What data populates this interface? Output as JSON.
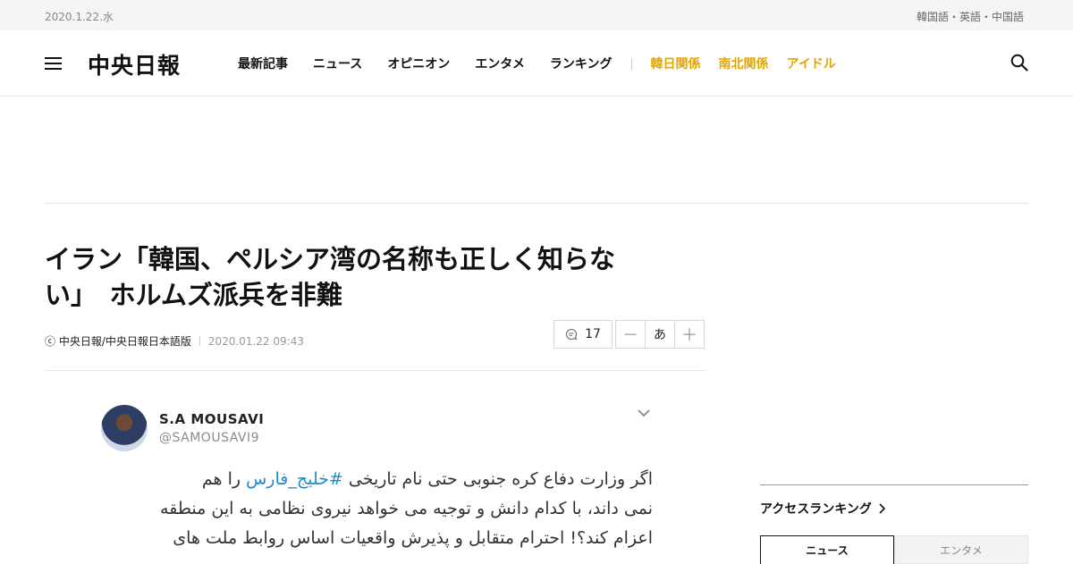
{
  "topbar": {
    "date": "2020.1.22.水",
    "languages": "韓国語・英語・中国語"
  },
  "header": {
    "logo": "中央日報",
    "nav": [
      "最新記事",
      "ニュース",
      "オピニオン",
      "エンタメ",
      "ランキング"
    ],
    "nav_highlight": [
      "韓日関係",
      "南北関係",
      "アイドル"
    ],
    "colors": {
      "highlight": "#e3a600"
    }
  },
  "article": {
    "headline_line1": "イラン「韓国、ペルシア湾の名称も正しく知らな",
    "headline_line2": "い」　ホルムズ派兵を非難",
    "byline": "ⓒ 中央日報/中央日報日本語版",
    "timestamp": "2020.01.22 09:43",
    "comment_count": "17",
    "font_small": "－",
    "font_label": "あ",
    "font_large": "＋"
  },
  "tweet": {
    "name": "S.A MOUSAVI",
    "handle": "@SAMOUSAVI9",
    "line1_prefix": "اگر وزارت دفاع کره جنوبی حتی نام تاریخی ",
    "hashtag": "#خلیج_فارس",
    "line1_suffix": " را هم",
    "line2": "نمی داند، با کدام دانش و توجیه می خواهد نیروی نظامی به این منطقه",
    "line3": "اعزام کند؟! احترام متقابل و پذیرش واقعیات  اساس روابط ملت های",
    "colors": {
      "hashtag": "#1d8ccf"
    }
  },
  "ranking": {
    "title": "アクセスランキング",
    "tabs": [
      "ニュース",
      "エンタメ"
    ]
  }
}
